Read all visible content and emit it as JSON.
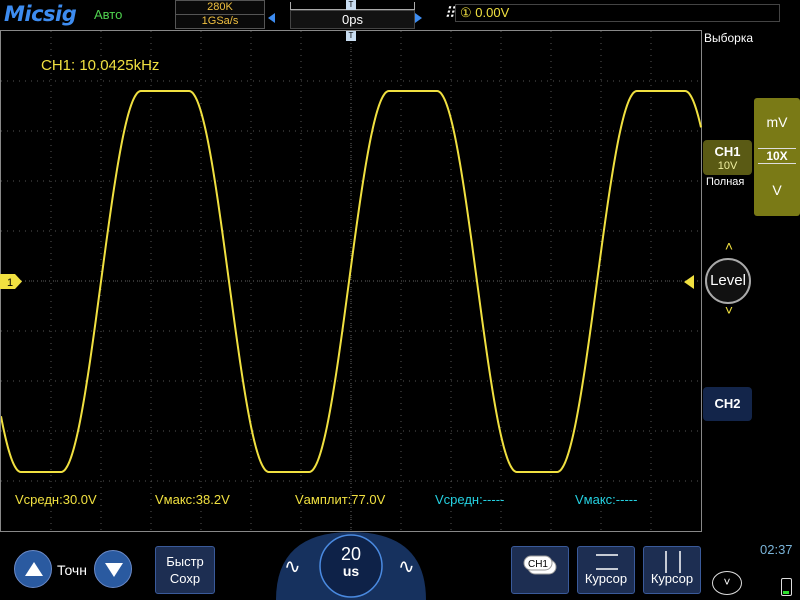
{
  "header": {
    "logo": "Micsig",
    "mode": "Авто",
    "memory_depth": "280K",
    "sample_rate": "1GSa/s",
    "time_position": "0ps",
    "trigger_source": "①",
    "trigger_level": "0.00V",
    "acquisition_label": "Выборка"
  },
  "plot": {
    "frequency_readout": "CH1: 10.0425kHz",
    "channel_marker": "1",
    "trigger_marker": "T",
    "measurements": [
      {
        "label": "Vсредн:30.0V",
        "color": "#f0e040"
      },
      {
        "label": "Vмакс:38.2V",
        "color": "#f0e040"
      },
      {
        "label": "Vамплит:77.0V",
        "color": "#f0e040"
      },
      {
        "label": "Vсредн:-----",
        "color": "#25d0e0"
      },
      {
        "label": "Vмакс:-----",
        "color": "#25d0e0"
      }
    ]
  },
  "right_panel": {
    "ch1_label": "CH1",
    "ch1_scale": "10V",
    "bandwidth_label": "Полная",
    "unit_top": "mV",
    "probe_ratio": "10X",
    "unit_bottom": "V",
    "level_label": "Level",
    "ch2_label": "CH2"
  },
  "bottom": {
    "adjust_label": "Точн",
    "fast_save_line1": "Быстр",
    "fast_save_line2": "Сохр",
    "timebase_value": "20",
    "timebase_unit": "us",
    "ch1_chip": "CH1",
    "cursor_h_label": "Курсор",
    "cursor_v_label": "Курсор",
    "clock": "02:37"
  },
  "colors": {
    "ch1": "#f0e040",
    "ch2": "#25d0e0",
    "accent": "#3d8cf0"
  }
}
